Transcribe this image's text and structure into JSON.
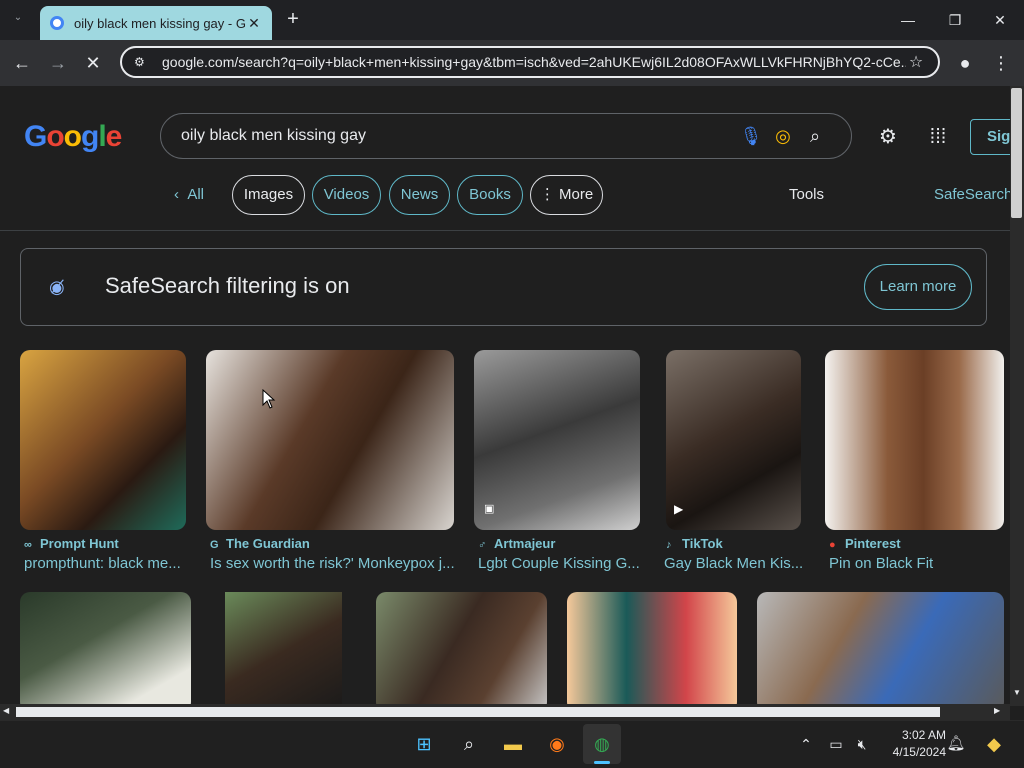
{
  "browser": {
    "tab_title": "oily black men kissing gay - Go",
    "tab_close": "✕",
    "new_tab": "+",
    "url": "google.com/search?q=oily+black+men+kissing+gay&tbm=isch&ved=2ahUKEwj6IL2d08OFAxWLLVkFHRNjBhYQ2-cCe...",
    "window": {
      "minimize": "—",
      "maximize": "❐",
      "close": "✕"
    }
  },
  "search": {
    "logo": "Google",
    "query": "oily black men kissing gay",
    "sign_in": "Sig"
  },
  "filters": {
    "all": "All",
    "chips": [
      "Images",
      "Videos",
      "News",
      "Books",
      "⋮ More"
    ],
    "tools": "Tools",
    "safesearch": "SafeSearch"
  },
  "banner": {
    "title": "SafeSearch filtering is on",
    "button": "Learn more"
  },
  "results_row1": [
    {
      "source": "Prompt Hunt",
      "caption": "prompthunt: black me...",
      "source_icon": "binoculars-icon"
    },
    {
      "source": "The Guardian",
      "caption": "Is sex worth the risk?' Monkeypox j...",
      "source_icon": "guardian-g-icon"
    },
    {
      "source": "Artmajeur",
      "caption": "Lgbt Couple Kissing G...",
      "source_icon": "artmajeur-icon"
    },
    {
      "source": "TikTok",
      "caption": "Gay Black Men Kis...",
      "source_icon": "tiktok-icon"
    },
    {
      "source": "Pinterest",
      "caption": "Pin on Black Fit",
      "source_icon": "pinterest-icon"
    }
  ],
  "taskbar": {
    "time": "3:02 AM",
    "date": "4/15/2024"
  },
  "colors": {
    "page_bg": "#1f1f1f",
    "link": "#7fc6d4",
    "tab_bg": "#9fd8e0"
  }
}
